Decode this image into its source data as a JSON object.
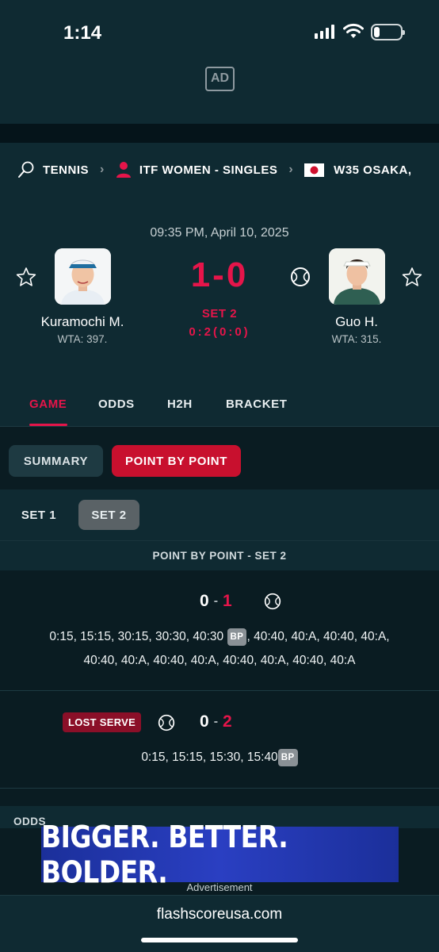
{
  "status_bar": {
    "time": "1:14"
  },
  "ad_top": {
    "badge": "AD"
  },
  "breadcrumb": {
    "sport": "TENNIS",
    "competition": "ITF WOMEN - SINGLES",
    "tournament": "W35 OSAKA,"
  },
  "match": {
    "datetime": "09:35 PM, April 10, 2025",
    "home": {
      "name": "Kuramochi M.",
      "rank": "WTA: 397."
    },
    "away": {
      "name": "Guo H.",
      "rank": "WTA: 315."
    },
    "score": "1-0",
    "status": "SET 2",
    "set_score": "0:2(0:0)"
  },
  "tabs": [
    "GAME",
    "ODDS",
    "H2H",
    "BRACKET"
  ],
  "subtabs": [
    "SUMMARY",
    "POINT BY POINT"
  ],
  "sets": [
    "SET 1",
    "SET 2"
  ],
  "section_title": "POINT BY POINT - SET 2",
  "games": [
    {
      "home": "0",
      "away": "1",
      "line1": "0:15, 15:15, 30:15, 30:30, 40:30",
      "line1_tail": ", 40:40, 40:A, 40:40, 40:A,",
      "line2": "40:40, 40:A, 40:40, 40:A, 40:40, 40:A, 40:40, 40:A",
      "bp": "BP"
    },
    {
      "badge": "LOST SERVE",
      "home": "0",
      "away": "2",
      "line1": "0:15, 15:15, 15:30, 15:40",
      "bp": "BP"
    }
  ],
  "odds_label": "ODDS",
  "ad_banner": {
    "text": "BIGGER. BETTER. BOLDER.",
    "caption": "Advertisement"
  },
  "url": "flashscoreusa.com",
  "colors": {
    "accent": "#e5154a",
    "background": "#0a1c22",
    "panel": "#0f2a32",
    "ad_blue": "#2a3fc2"
  },
  "icons": [
    "tennis-racket-icon",
    "person-icon",
    "japan-flag-icon",
    "star-icon",
    "tennis-ball-icon",
    "signal-icon",
    "wifi-icon",
    "battery-icon"
  ]
}
